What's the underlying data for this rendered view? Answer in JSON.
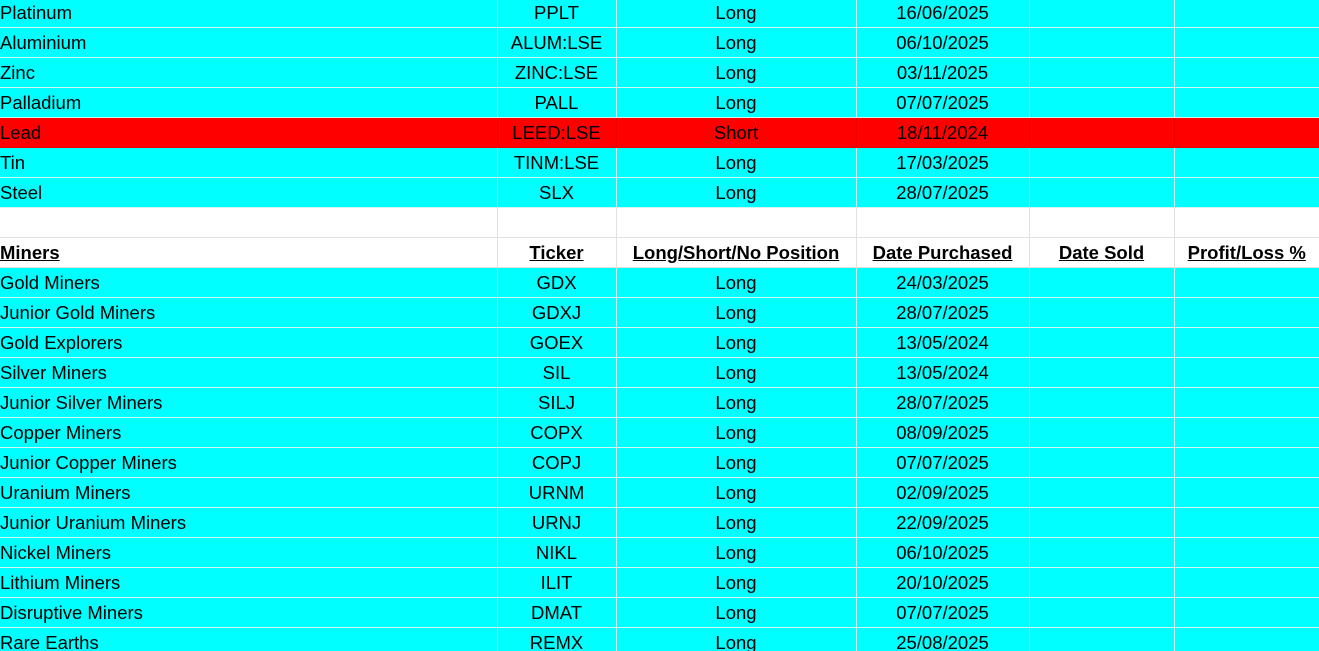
{
  "colors": {
    "long_row": "#00ffff",
    "short_row": "#ff0000",
    "grid_line": "#e2e2e2",
    "background": "#ffffff"
  },
  "metals": [
    {
      "name": "Platinum",
      "ticker": "PPLT",
      "position": "Long",
      "date_purchased": "16/06/2025"
    },
    {
      "name": "Aluminium",
      "ticker": "ALUM:LSE",
      "position": "Long",
      "date_purchased": "06/10/2025"
    },
    {
      "name": "Zinc",
      "ticker": "ZINC:LSE",
      "position": "Long",
      "date_purchased": "03/11/2025"
    },
    {
      "name": "Palladium",
      "ticker": "PALL",
      "position": "Long",
      "date_purchased": "07/07/2025"
    },
    {
      "name": "Lead",
      "ticker": "LEED:LSE",
      "position": "Short",
      "date_purchased": "18/11/2024"
    },
    {
      "name": "Tin",
      "ticker": "TINM:LSE",
      "position": "Long",
      "date_purchased": "17/03/2025"
    },
    {
      "name": "Steel",
      "ticker": "SLX",
      "position": "Long",
      "date_purchased": "28/07/2025"
    }
  ],
  "miners_header": {
    "name": "Miners",
    "ticker": "Ticker",
    "position": "Long/Short/No Position",
    "date_purchased": "Date Purchased",
    "date_sold": "Date Sold",
    "profit_loss": "Profit/Loss %"
  },
  "miners": [
    {
      "name": "Gold Miners",
      "ticker": "GDX",
      "position": "Long",
      "date_purchased": "24/03/2025"
    },
    {
      "name": "Junior Gold Miners",
      "ticker": "GDXJ",
      "position": "Long",
      "date_purchased": "28/07/2025"
    },
    {
      "name": "Gold Explorers",
      "ticker": "GOEX",
      "position": "Long",
      "date_purchased": "13/05/2024"
    },
    {
      "name": "Silver Miners",
      "ticker": "SIL",
      "position": "Long",
      "date_purchased": "13/05/2024"
    },
    {
      "name": "Junior Silver Miners",
      "ticker": "SILJ",
      "position": "Long",
      "date_purchased": "28/07/2025"
    },
    {
      "name": "Copper Miners",
      "ticker": "COPX",
      "position": "Long",
      "date_purchased": "08/09/2025"
    },
    {
      "name": "Junior Copper Miners",
      "ticker": "COPJ",
      "position": "Long",
      "date_purchased": "07/07/2025"
    },
    {
      "name": "Uranium Miners",
      "ticker": "URNM",
      "position": "Long",
      "date_purchased": "02/09/2025"
    },
    {
      "name": "Junior Uranium Miners",
      "ticker": "URNJ",
      "position": "Long",
      "date_purchased": "22/09/2025"
    },
    {
      "name": "Nickel Miners",
      "ticker": "NIKL",
      "position": "Long",
      "date_purchased": "06/10/2025"
    },
    {
      "name": "Lithium Miners",
      "ticker": "ILIT",
      "position": "Long",
      "date_purchased": "20/10/2025"
    },
    {
      "name": "Disruptive Miners",
      "ticker": "DMAT",
      "position": "Long",
      "date_purchased": "07/07/2025"
    },
    {
      "name": "Rare Earths",
      "ticker": "REMX",
      "position": "Long",
      "date_purchased": "25/08/2025"
    }
  ]
}
